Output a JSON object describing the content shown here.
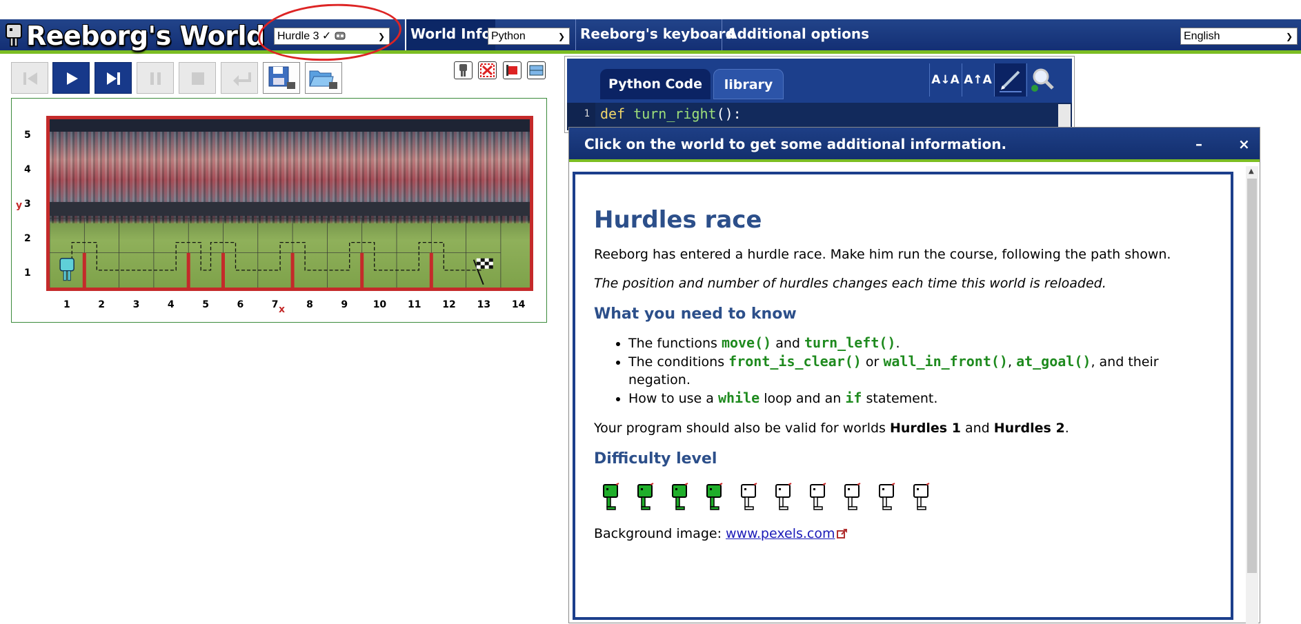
{
  "header": {
    "logo_text": "Reeborg's World",
    "world_select": "Hurdle 3 ✓",
    "world_info_label": "World Info",
    "code_language": "Python",
    "keyboard_label": "Reeborg's keyboard",
    "additional_label": "Additional options",
    "ui_language": "English"
  },
  "world": {
    "y_ticks": [
      "5",
      "4",
      "3",
      "2",
      "1"
    ],
    "x_ticks": [
      "1",
      "2",
      "3",
      "4",
      "5",
      "6",
      "7",
      "8",
      "9",
      "10",
      "11",
      "12",
      "13",
      "14"
    ],
    "y_axis_letter": "y",
    "x_axis_letter": "x"
  },
  "editor": {
    "tab_code": "Python Code",
    "tab_library": "library",
    "line_number": "1",
    "code_keyword": "def ",
    "code_function": "turn_right",
    "code_punctuation": "():",
    "tool_decrease_font": "A↓A",
    "tool_increase_font": "A↑A"
  },
  "dialog": {
    "title": "Click on the world to get some additional information.",
    "minimize": "–",
    "close": "×",
    "heading": "Hurdles race",
    "intro": "Reeborg has entered a hurdle race. Make him run the course, following the path shown.",
    "note": "The position and number of hurdles changes each time this world is reloaded.",
    "what_heading": "What you need to know",
    "bullet1_prefix": "The functions ",
    "bullet1_code1": "move()",
    "bullet1_and": " and ",
    "bullet1_code2": "turn_left()",
    "bullet1_end": ".",
    "bullet2_prefix": "The conditions ",
    "bullet2_code1": "front_is_clear()",
    "bullet2_or": " or ",
    "bullet2_code2": "wall_in_front()",
    "bullet2_comma": ", ",
    "bullet2_code3": "at_goal()",
    "bullet2_end": ", and their negation.",
    "bullet3_prefix": "How to use a ",
    "bullet3_code1": "while",
    "bullet3_mid": " loop and an ",
    "bullet3_code2": "if",
    "bullet3_end": " statement.",
    "valid_prefix": "Your program should also be valid for worlds ",
    "valid_w1": "Hurdles 1",
    "valid_and": " and ",
    "valid_w2": "Hurdles 2",
    "valid_end": ".",
    "difficulty_heading": "Difficulty level",
    "difficulty": {
      "level": 4,
      "max": 10
    },
    "bg_prefix": "Background image: ",
    "bg_link": "www.pexels.com"
  },
  "colors": {
    "header_blue": "#132f74",
    "accent_green": "#7cbd22",
    "wall_red": "#c42a2a",
    "title_blue": "#2c4f8a",
    "code_green": "#1e8a1e"
  }
}
